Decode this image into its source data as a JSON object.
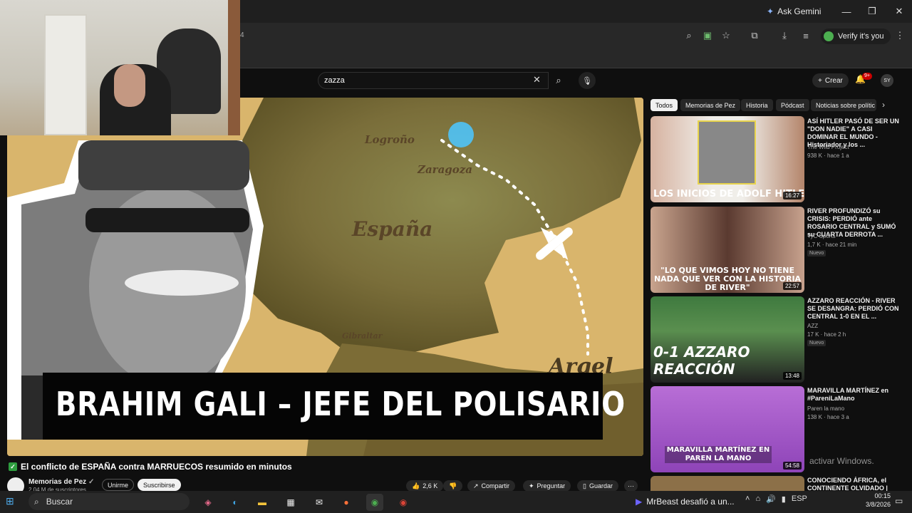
{
  "browser": {
    "gemini_label": "Ask Gemini",
    "verify_label": "Verify it's you",
    "tab_fragment": "4"
  },
  "youtube": {
    "search_value": "zazza",
    "create_label": "Crear",
    "notification_count": "9+",
    "avatar_initials": "SY"
  },
  "video": {
    "overlay_title": "BRAHIM GALI – JEFE DEL POLISARIO",
    "map_labels": {
      "logrono": "Logroño",
      "zaragoza": "Zaragoza",
      "espana": "España",
      "gibraltar": "Gibraltar",
      "argel": "Argel"
    },
    "title": "El conflicto de ESPAÑA contra MARRUECOS resumido en minutos",
    "channel": "Memorias de Pez",
    "subscribers": "2,04 M de suscriptores",
    "join_label": "Unirme",
    "subscribe_label": "Suscribirse",
    "likes": "2,6 K",
    "share_label": "Compartir",
    "ask_label": "Preguntar",
    "save_label": "Guardar"
  },
  "chips": [
    "Todos",
    "Memorias de Pez",
    "Historia",
    "Pódcast",
    "Noticias sobre polític"
  ],
  "recommendations": [
    {
      "title": "ASÍ HITLER PASÓ DE SER UN \"DON NADIE\" A CASI DOMINAR EL MUNDO - Historiador y los ...",
      "channel": "The Wild Project",
      "meta": "938 K · hace 1 a",
      "duration": "16:27",
      "thumb_text": "LOS INICIOS DE ADOLF HITLER",
      "new": ""
    },
    {
      "title": "RIVER PROFUNDIZÓ su CRISIS: PERDIÓ ante ROSARIO CENTRAL y SUMÓ su CUARTA DERROTA ...",
      "channel": "TyC Sports",
      "meta": "1,7 K · hace 21 min",
      "duration": "22:57",
      "thumb_text": "\"LO QUE VIMOS HOY NO TIENE NADA QUE VER CON LA HISTORIA DE RIVER\"",
      "new": "Nuevo"
    },
    {
      "title": "AZZARO REACCIÓN - RIVER SE DESANGRA: PERDIÓ CON CENTRAL 1-0 EN EL ...",
      "channel": "AZZ",
      "meta": "17 K · hace 2 h",
      "duration": "13:48",
      "thumb_text": "0-1 AZZARO REACCIÓN",
      "new": "Nuevo"
    },
    {
      "title": "MARAVILLA MARTÍNEZ en #PareniLaMano",
      "channel": "Paren la mano",
      "meta": "138 K · hace 3 a",
      "duration": "54:58",
      "thumb_text": "MARAVILLA MARTÍNEZ EN PAREN LA MANO",
      "new": ""
    },
    {
      "title": "CONOCIENDO ÁFRICA, el CONTINENTE OLVIDADO | Kevin",
      "channel": "",
      "meta": "",
      "duration": "",
      "thumb_text": "",
      "new": ""
    }
  ],
  "windows": {
    "search_placeholder": "Buscar",
    "watermark": "activar Windows.",
    "notification": "MrBeast desafió a un...",
    "language": "ESP",
    "time": "00:15",
    "date": "3/8/2026"
  }
}
